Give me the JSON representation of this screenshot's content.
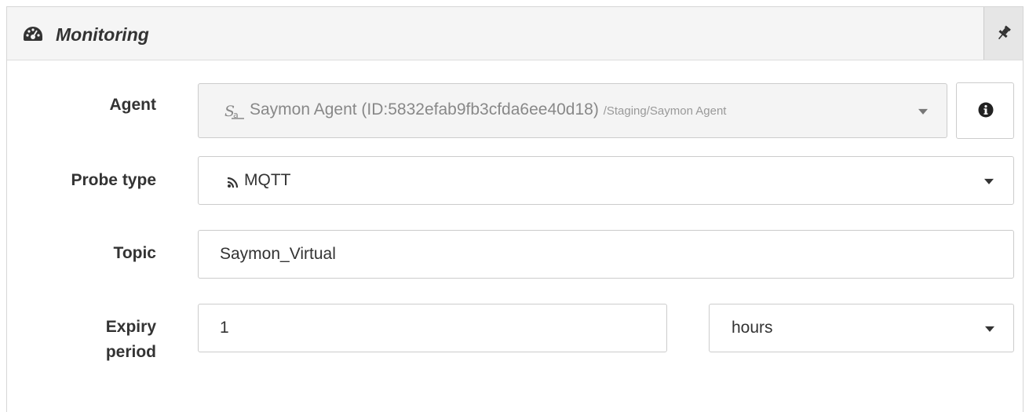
{
  "panel": {
    "title": "Monitoring",
    "header_icon": "dashboard-icon",
    "pin_icon": "pin-icon"
  },
  "form": {
    "agent": {
      "label": "Agent",
      "value": "Saymon Agent (ID:5832efab9fb3cfda6ee40d18)",
      "path": "/Staging/Saymon Agent",
      "icon": "agent-icon",
      "info_icon": "info-icon",
      "disabled": true
    },
    "probe_type": {
      "label": "Probe type",
      "value": "MQTT",
      "icon": "rss-icon"
    },
    "topic": {
      "label": "Topic",
      "value": "Saymon_Virtual"
    },
    "expiry_period": {
      "label_line1": "Expiry",
      "label_line2": "period",
      "value": "1",
      "unit": "hours"
    }
  },
  "colors": {
    "header_bg": "#f5f5f5",
    "pin_bg": "#e6e6e6",
    "border": "#cccccc",
    "disabled_bg": "#f4f4f4",
    "text": "#333333",
    "muted_text": "#888888"
  }
}
